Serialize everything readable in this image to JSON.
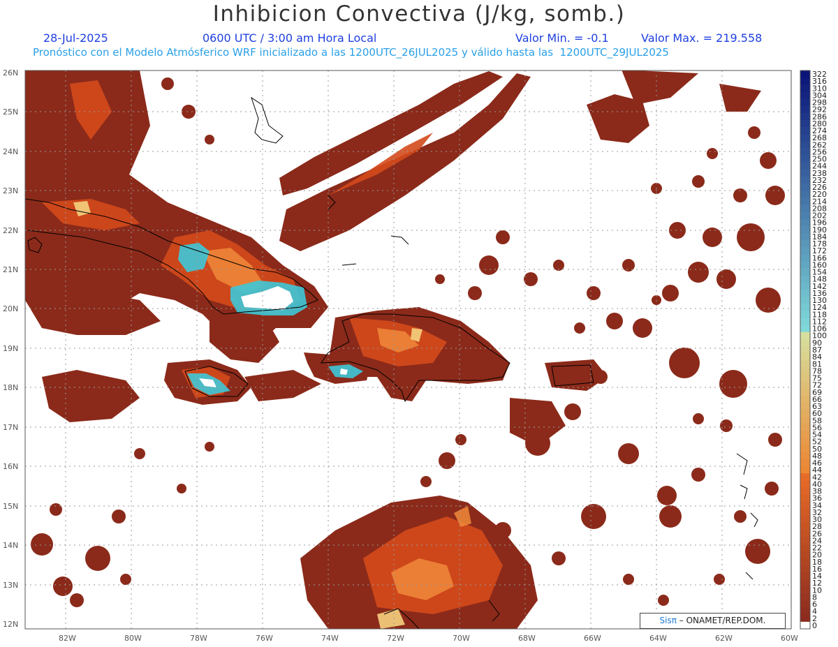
{
  "title": "Inhibicion Convectiva (J/kg, somb.)",
  "header": {
    "date": "28-Jul-2025",
    "time": "0600 UTC / 3:00 am Hora Local",
    "min_label": "Valor Min. = -0.1",
    "max_label": "Valor Max. = 219.558",
    "forecast": "Pronóstico con el Modelo Atmósferico WRF inicializado a las 1200UTC_26JUL2025 y válido hasta las  1200UTC_29JUL2025"
  },
  "axes": {
    "lat_labels": [
      "26N",
      "25N",
      "24N",
      "23N",
      "22N",
      "21N",
      "20N",
      "19N",
      "18N",
      "17N",
      "16N",
      "15N",
      "14N",
      "13N",
      "12N"
    ],
    "lon_labels": [
      "82W",
      "80W",
      "78W",
      "76W",
      "74W",
      "72W",
      "70W",
      "68W",
      "66W",
      "64W",
      "62W",
      "60W"
    ]
  },
  "colorbar": {
    "labels": [
      "322",
      "316",
      "310",
      "304",
      "298",
      "292",
      "286",
      "280",
      "274",
      "268",
      "262",
      "256",
      "250",
      "244",
      "238",
      "232",
      "226",
      "220",
      "214",
      "208",
      "202",
      "196",
      "190",
      "184",
      "178",
      "172",
      "166",
      "160",
      "154",
      "148",
      "142",
      "136",
      "130",
      "124",
      "118",
      "112",
      "106",
      "100",
      "90",
      "87",
      "84",
      "81",
      "78",
      "75",
      "72",
      "69",
      "66",
      "63",
      "60",
      "58",
      "56",
      "54",
      "52",
      "50",
      "48",
      "46",
      "44",
      "42",
      "40",
      "38",
      "36",
      "34",
      "32",
      "30",
      "28",
      "26",
      "24",
      "22",
      "20",
      "18",
      "16",
      "14",
      "12",
      "10",
      "8",
      "6",
      "4",
      "2",
      "0"
    ]
  },
  "logo": {
    "brand": "Sisπ",
    "text": "– ONAMET/REP.DOM."
  },
  "colors": {
    "title": "#333333",
    "date": "#1f3fe0",
    "forecast": "#2aa0e8",
    "cin_low": "#8b2a1a",
    "cin_mid": "#e05a1e",
    "cin_high": "#f5d080",
    "cin_peak": "#3ec8d8"
  }
}
